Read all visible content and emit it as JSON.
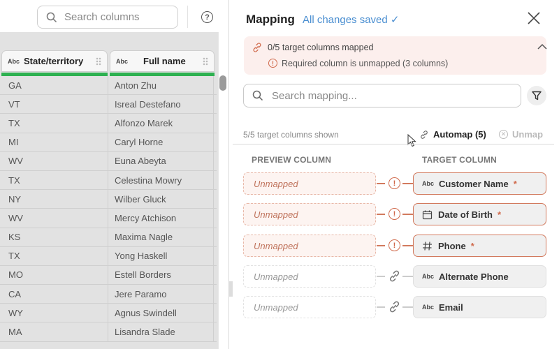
{
  "left_panel": {
    "search": {
      "placeholder": "Search columns",
      "icon": "search-icon"
    },
    "help_icon": "question-circle-icon",
    "help_glyph": "?",
    "columns": [
      {
        "type_label": "Abc",
        "name": "State/territory"
      },
      {
        "type_label": "Abc",
        "name": "Full name"
      }
    ],
    "rows": [
      [
        "GA",
        "Anton Zhu"
      ],
      [
        "VT",
        "Isreal Destefano"
      ],
      [
        "TX",
        "Alfonzo Marek"
      ],
      [
        "MI",
        "Caryl Horne"
      ],
      [
        "WV",
        "Euna Abeyta"
      ],
      [
        "TX",
        "Celestina Mowry"
      ],
      [
        "NY",
        "Wilber Gluck"
      ],
      [
        "WV",
        "Mercy Atchison"
      ],
      [
        "KS",
        "Maxima Nagle"
      ],
      [
        "TX",
        "Yong Haskell"
      ],
      [
        "MO",
        "Estell Borders"
      ],
      [
        "CA",
        "Jere Paramo"
      ],
      [
        "WY",
        "Agnus Swindell"
      ],
      [
        "MA",
        "Lisandra Slade"
      ]
    ]
  },
  "mapping": {
    "title": "Mapping",
    "save_status": "All changes saved ✓",
    "close_icon": "close-icon",
    "banner": {
      "summary": "0/5 target columns mapped",
      "warning": "Required column is unmapped (3 columns)",
      "warning_glyph": "!"
    },
    "search": {
      "placeholder": "Search mapping...",
      "icon": "search-icon"
    },
    "filter_icon": "filter-icon",
    "shown_text": "5/5 target columns shown",
    "automap_label": "Automap (5)",
    "unmap_label": "Unmap",
    "unmap_glyph": "✕",
    "preview_column_header": "PREVIEW COLUMN",
    "target_column_header": "TARGET COLUMN",
    "rows": [
      {
        "source": "Unmapped",
        "status": "error",
        "status_glyph": "!",
        "target_type": "Abc",
        "target_icon": "text-type-icon",
        "target": "Customer Name",
        "required": "*"
      },
      {
        "source": "Unmapped",
        "status": "error",
        "status_glyph": "!",
        "target_type": "",
        "target_icon": "calendar-icon",
        "target": "Date of Birth",
        "required": "*"
      },
      {
        "source": "Unmapped",
        "status": "error",
        "status_glyph": "!",
        "target_type": "",
        "target_icon": "hash-icon",
        "target": "Phone",
        "required": "*"
      },
      {
        "source": "Unmapped",
        "status": "link",
        "target_type": "Abc",
        "target_icon": "text-type-icon",
        "target": "Alternate Phone",
        "required": ""
      },
      {
        "source": "Unmapped",
        "status": "link",
        "target_type": "Abc",
        "target_icon": "text-type-icon",
        "target": "Email",
        "required": ""
      }
    ],
    "colors": {
      "error": "#d06a4c",
      "accent_blue": "#4b8fd1",
      "valid_green": "#2db150",
      "banner_bg": "#fcefed"
    }
  }
}
